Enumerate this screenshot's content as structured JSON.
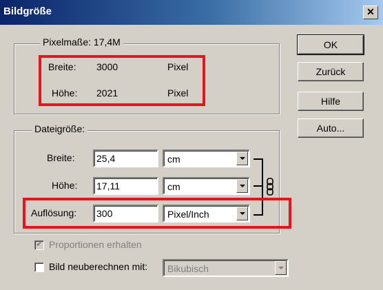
{
  "window": {
    "title": "Bildgröße"
  },
  "pixel_dimensions": {
    "legend": "Pixelmaße: 17,4M",
    "width_label": "Breite:",
    "width_value": "3000",
    "width_unit": "Pixel",
    "height_label": "Höhe:",
    "height_value": "2021",
    "height_unit": "Pixel"
  },
  "document_size": {
    "legend": "Dateigröße:",
    "width_label": "Breite:",
    "width_value": "25,4",
    "width_unit": "cm",
    "height_label": "Höhe:",
    "height_value": "17,11",
    "height_unit": "cm",
    "resolution_label": "Auflösung:",
    "resolution_value": "300",
    "resolution_unit": "Pixel/Inch"
  },
  "options": {
    "constrain_label": "Proportionen erhalten",
    "constrain_checked": true,
    "resample_label": "Bild neuberechnen mit:",
    "resample_checked": false,
    "resample_method": "Bikubisch"
  },
  "buttons": {
    "ok": "OK",
    "reset": "Zurück",
    "help": "Hilfe",
    "auto": "Auto..."
  },
  "highlight_color": "#e8141c"
}
